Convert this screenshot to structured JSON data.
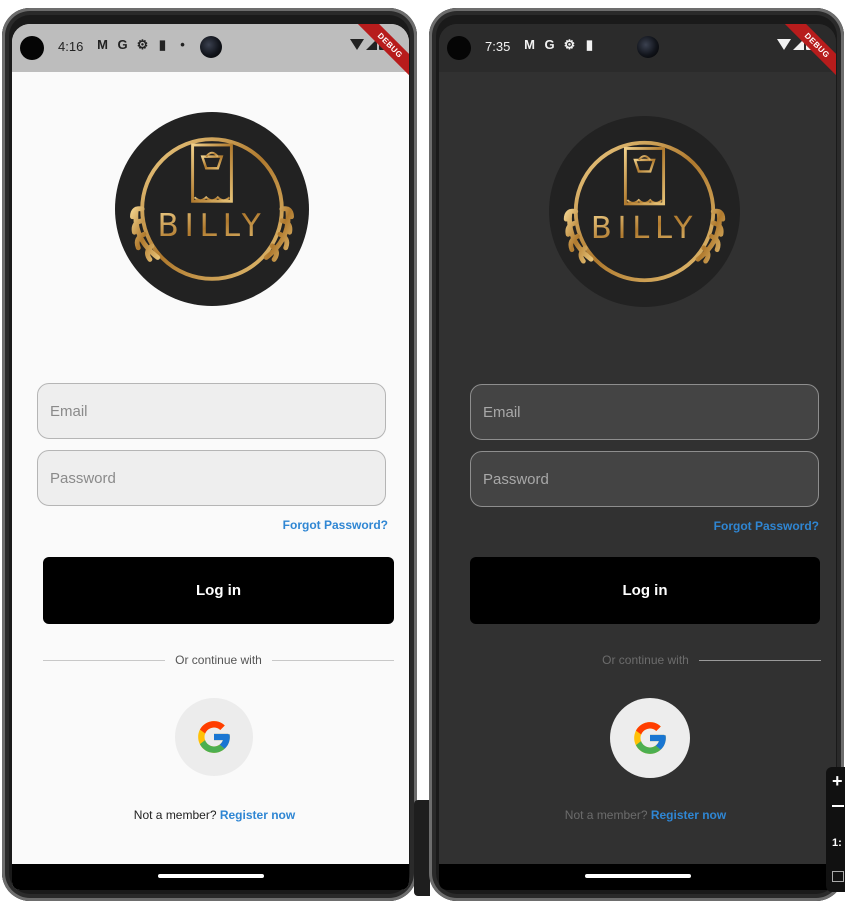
{
  "screens": [
    {
      "theme": "light",
      "status_bar": {
        "time": "4:16",
        "icons": [
          "gmail-icon",
          "google-icon",
          "settings-icon",
          "sd-card-icon",
          "dot-icon"
        ],
        "glyphs": [
          "M",
          "G",
          "⚙",
          "▮",
          "•"
        ],
        "debug_banner": "DEBUG"
      },
      "logo_text": "BILLY",
      "email_placeholder": "Email",
      "password_placeholder": "Password",
      "forgot_password": "Forgot Password?",
      "login_label": "Log in",
      "divider_text": "Or continue with",
      "register_prompt": "Not a member?",
      "register_link": "Register now"
    },
    {
      "theme": "dark",
      "status_bar": {
        "time": "7:35",
        "icons": [
          "gmail-icon",
          "google-icon",
          "settings-icon",
          "sd-card-icon"
        ],
        "glyphs": [
          "M",
          "G",
          "⚙",
          "▮"
        ],
        "debug_banner": "DEBUG"
      },
      "logo_text": "BILLY",
      "email_placeholder": "Email",
      "password_placeholder": "Password",
      "forgot_password": "Forgot Password?",
      "login_label": "Log in",
      "divider_text": "Or continue with",
      "register_prompt": "Not a member?",
      "register_link": "Register now"
    }
  ],
  "side_panel": {
    "zoom_in": "+",
    "ratio": "1:"
  },
  "colors": {
    "accent_link": "#2f86d3",
    "button_bg": "#000000",
    "logo_bg": "#222222",
    "gold": "#c99a4a",
    "light_bg": "#fafafa",
    "dark_bg": "#313131"
  }
}
